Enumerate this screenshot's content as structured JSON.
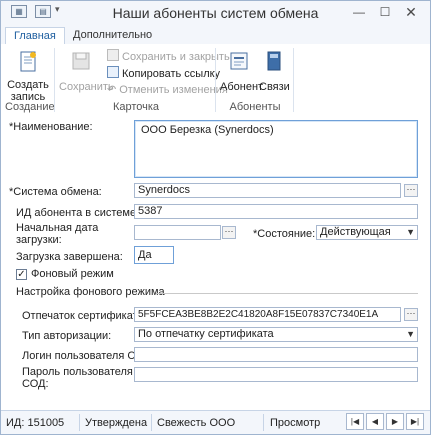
{
  "window": {
    "title": "Наши абоненты систем обмена"
  },
  "tabs": [
    {
      "label": "Главная"
    },
    {
      "label": "Дополнительно"
    }
  ],
  "ribbon": {
    "create": {
      "label_line1": "Создать",
      "label_line2": "запись",
      "group": "Создание"
    },
    "save": {
      "label": "Сохранить"
    },
    "save_close": {
      "label": "Сохранить и закрыть"
    },
    "copy_link": {
      "label": "Копировать ссылку"
    },
    "cancel_changes": {
      "label": "Отменить изменения"
    },
    "card_group": "Карточка",
    "subscriber": {
      "label": "Абонент"
    },
    "links": {
      "label": "Связи"
    },
    "subscribers_group": "Абоненты"
  },
  "form": {
    "name_label": "*Наименование:",
    "name_value": "ООО Березка (Synerdocs)",
    "exchange_system_label": "*Система обмена:",
    "exchange_system_value": "Synerdocs",
    "subscriber_id_label": "ИД абонента в системе:",
    "subscriber_id_value": "5387",
    "load_start_label_1": "Начальная дата",
    "load_start_label_2": "загрузки:",
    "load_start_value": "",
    "state_label": "*Состояние:",
    "state_value": "Действующая",
    "load_complete_label": "Загрузка завершена:",
    "load_complete_value": "Да",
    "background_mode_label": "Фоновый режим",
    "background_mode_checked": true,
    "bg_section_title": "Настройка фонового режима",
    "cert_thumb_label": "Отпечаток сертификата:",
    "cert_thumb_value": "5F5FCEA3BE8B2E2C41820A8F15E07837C7340E1A",
    "auth_type_label": "Тип авторизации:",
    "auth_type_value": "По отпечатку сертификата",
    "login_label": "Логин пользователя СОД:",
    "login_value": "",
    "password_label_1": "Пароль пользователя",
    "password_label_2": "СОД:",
    "password_value": ""
  },
  "status": {
    "id": "ИД: 151005",
    "state": "Утверждена",
    "org": "Свежесть ООО",
    "mode": "Просмотр"
  }
}
